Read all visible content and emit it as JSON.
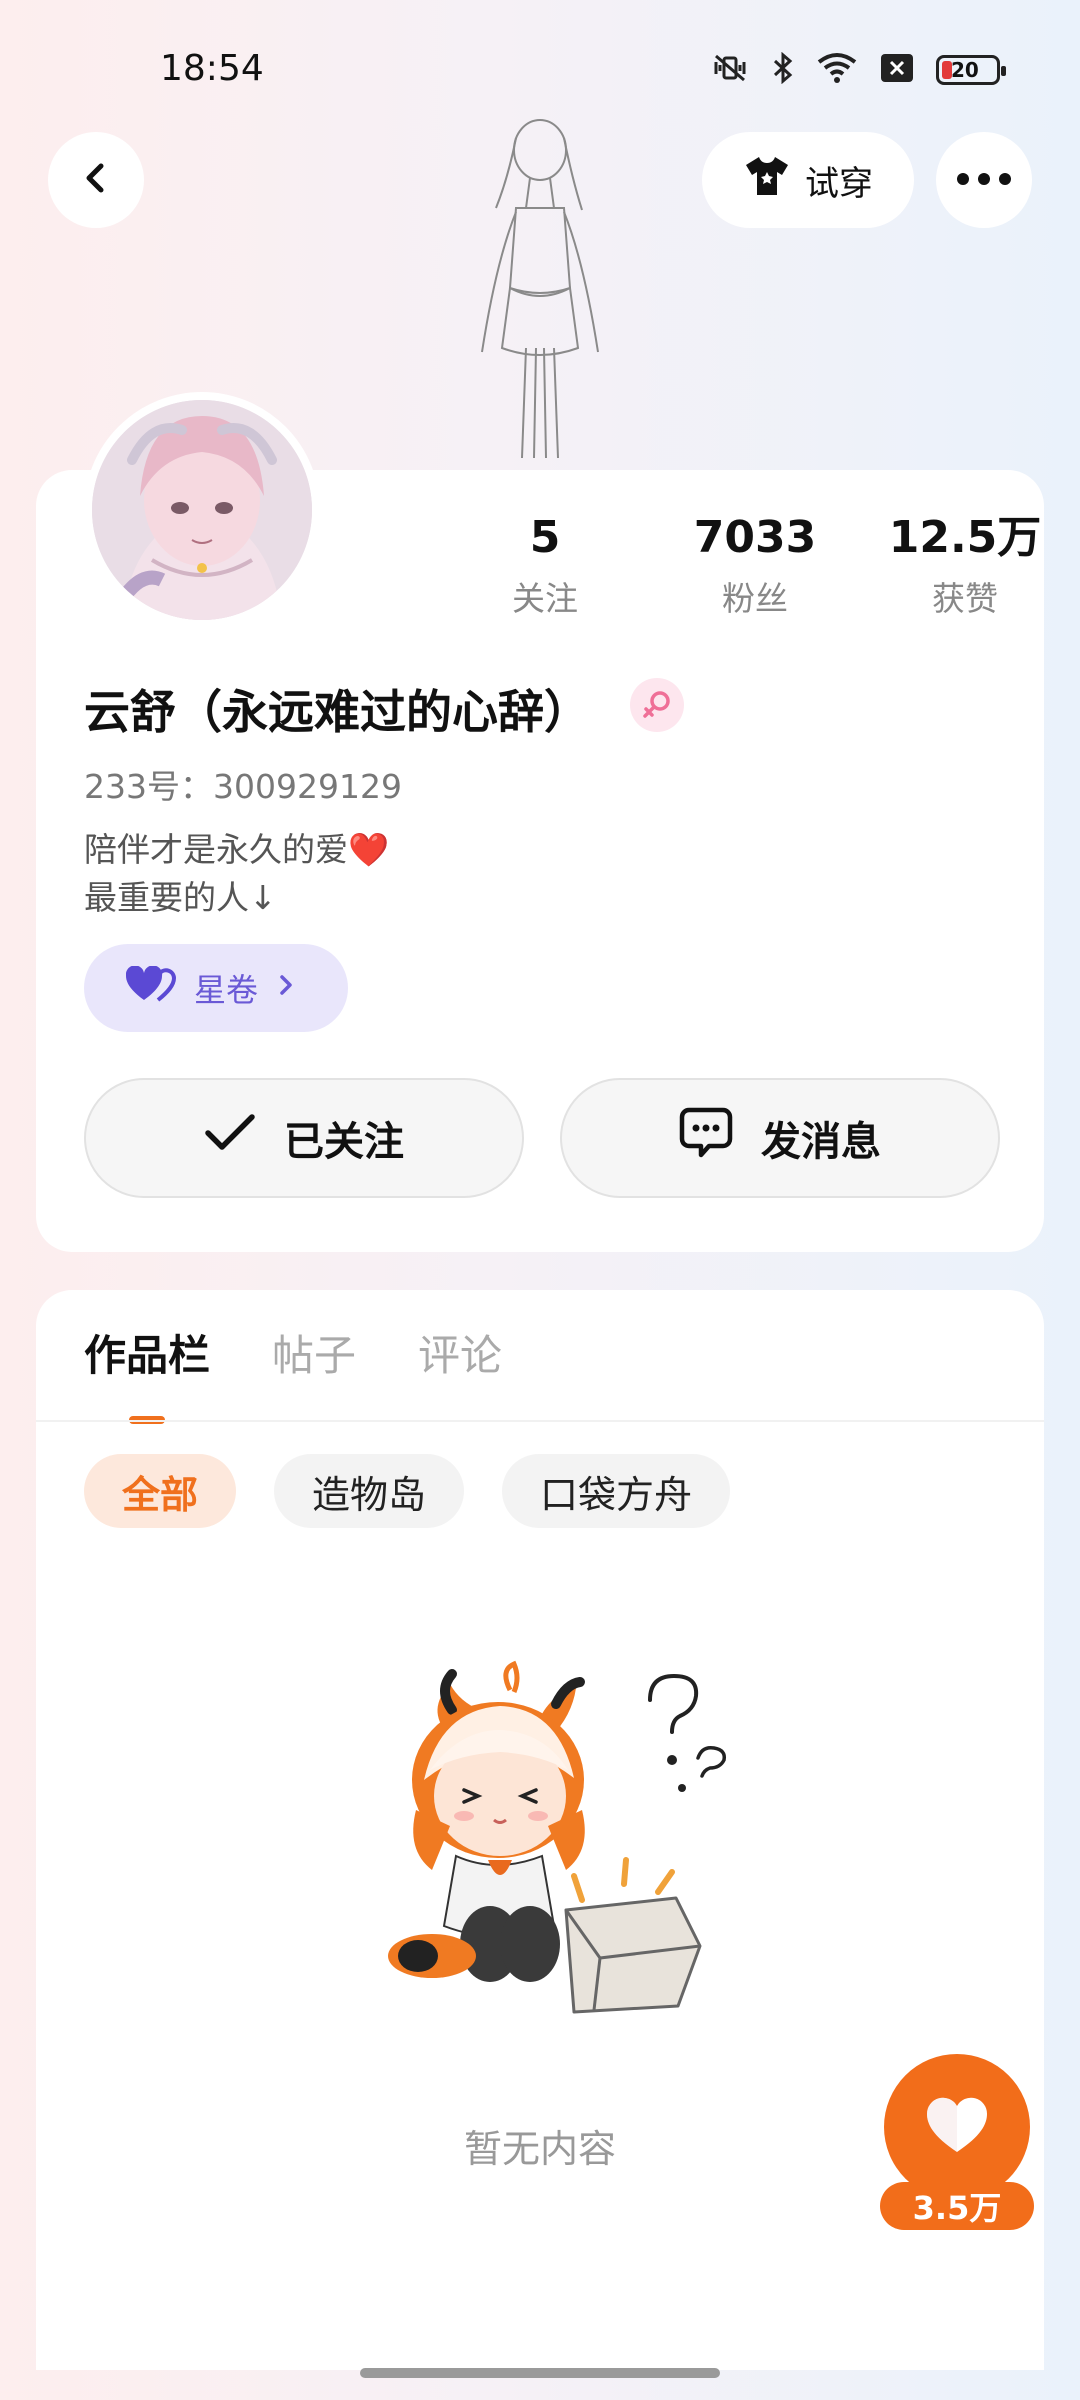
{
  "status_bar": {
    "time": "18:54",
    "battery_level": "20",
    "icons": [
      "mute-vibrate-icon",
      "bluetooth-icon",
      "wifi-icon",
      "sim-off-icon",
      "battery-icon"
    ]
  },
  "header": {
    "back_icon": "chevron-left-icon",
    "tryon_label": "试穿",
    "tryon_icon": "tshirt-icon",
    "more_icon": "more-dots-icon"
  },
  "profile": {
    "stats": [
      {
        "value": "5",
        "label": "关注"
      },
      {
        "value": "7033",
        "label": "粉丝"
      },
      {
        "value": "12.5万",
        "label": "获赞"
      }
    ],
    "username": "云舒（永远难过的心辞）",
    "gender": "female",
    "uid_text": "233号：300929129",
    "bio_line1": "陪伴才是永久的爱",
    "bio_line1_emoji": "❤️",
    "bio_line2": "最重要的人↓",
    "xingjuan_label": "星卷",
    "follow_button_label": "已关注",
    "message_button_label": "发消息"
  },
  "works": {
    "tabs": [
      "作品栏",
      "帖子",
      "评论"
    ],
    "active_tab": 0,
    "filters": [
      "全部",
      "造物岛",
      "口袋方舟"
    ],
    "active_filter": 0,
    "empty_text": "暂无内容"
  },
  "like_fab": {
    "count": "3.5万"
  },
  "colors": {
    "accent": "#f26d1a",
    "xingjuan_bg": "#e9e6fb",
    "xingjuan_text": "#6a59d6"
  }
}
